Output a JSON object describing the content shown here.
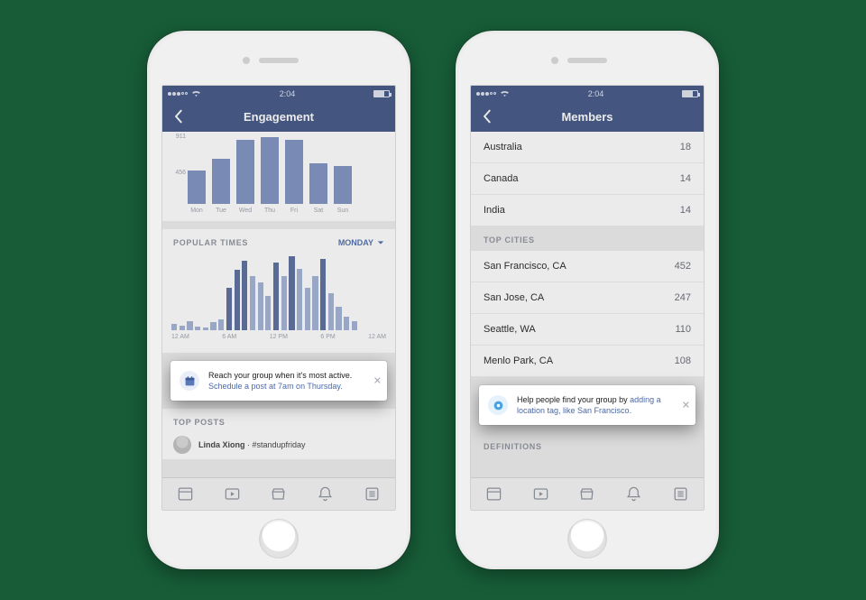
{
  "status": {
    "time": "2:04"
  },
  "left": {
    "title": "Engagement",
    "chart_data": [
      {
        "type": "bar",
        "categories": [
          "Mon",
          "Tue",
          "Wed",
          "Thu",
          "Fri",
          "Sat",
          "Sun"
        ],
        "values": [
          456,
          620,
          870,
          911,
          880,
          560,
          520
        ],
        "yticks": [
          "911",
          "456"
        ],
        "ylim": [
          0,
          911
        ]
      },
      {
        "type": "bar",
        "title": "POPULAR TIMES",
        "selector": "MONDAY",
        "categories_ticks": [
          "12 AM",
          "6 AM",
          "12 PM",
          "6 PM",
          "12 AM"
        ],
        "values": [
          8,
          6,
          12,
          5,
          4,
          10,
          14,
          55,
          78,
          90,
          70,
          62,
          45,
          88,
          70,
          96,
          80,
          55,
          70,
          92,
          48,
          30,
          18,
          12
        ],
        "peak_indices": [
          7,
          8,
          9,
          13,
          15,
          19
        ]
      }
    ],
    "tip": {
      "line1": "Reach your group when it's most active.",
      "line2": "Schedule a post at 7am on Thursday."
    },
    "top_posts": {
      "header": "TOP POSTS",
      "author": "Linda Xiong",
      "sep": " · ",
      "hashtag": "#standupfriday"
    }
  },
  "right": {
    "title": "Members",
    "countries": [
      {
        "name": "Australia",
        "count": 18
      },
      {
        "name": "Canada",
        "count": 14
      },
      {
        "name": "India",
        "count": 14
      }
    ],
    "cities_header": "TOP CITIES",
    "cities": [
      {
        "name": "San Francisco, CA",
        "count": 452
      },
      {
        "name": "San Jose, CA",
        "count": 247
      },
      {
        "name": "Seattle, WA",
        "count": 110
      },
      {
        "name": "Menlo Park, CA",
        "count": 108
      }
    ],
    "tip": {
      "line1": "Help people find your group by ",
      "link": "adding a location tag, like San Francisco."
    },
    "definitions_header": "DEFINITIONS"
  }
}
